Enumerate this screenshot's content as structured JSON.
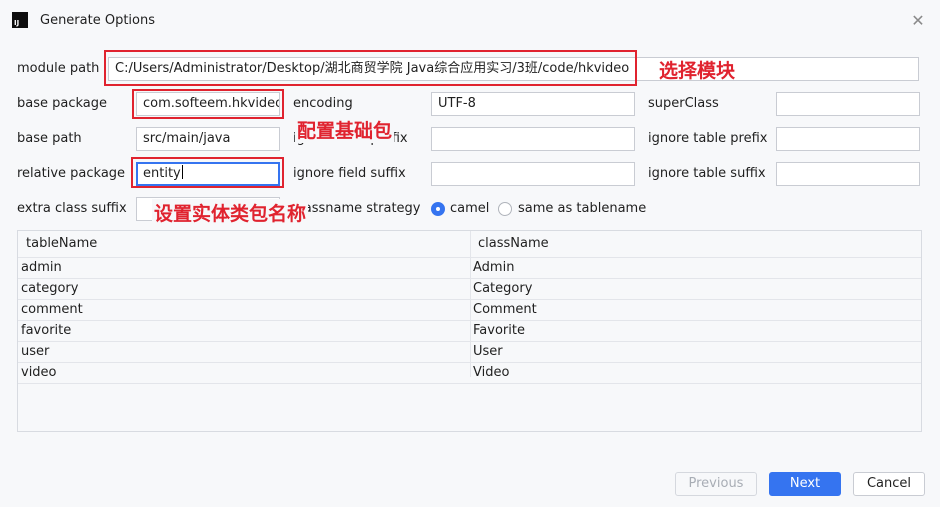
{
  "window": {
    "title": "Generate Options",
    "app_icon_text": "IJ",
    "close_icon": "close-icon"
  },
  "form": {
    "module_path": {
      "label": "module path",
      "value": "C:/Users/Administrator/Desktop/湖北商贸学院 Java综合应用实习/3班/code/hkvideo"
    },
    "base_package": {
      "label": "base package",
      "value": "com.softeem.hkvideo"
    },
    "encoding": {
      "label": "encoding",
      "value": "UTF-8"
    },
    "super_class": {
      "label": "superClass",
      "value": ""
    },
    "base_path": {
      "label": "base path",
      "value": "src/main/java"
    },
    "ignore_field_prefix": {
      "label": "ignore field prefix",
      "value": ""
    },
    "ignore_table_prefix": {
      "label": "ignore table prefix",
      "value": ""
    },
    "relative_package": {
      "label": "relative package",
      "value": "entity"
    },
    "ignore_field_suffix": {
      "label": "ignore field suffix",
      "value": ""
    },
    "ignore_table_suffix": {
      "label": "ignore table suffix",
      "value": ""
    },
    "extra_class_suffix": {
      "label": "extra class suffix",
      "value": ""
    },
    "class_name_strategy": {
      "label": "classname strategy",
      "options": [
        "camel",
        "same as tablename"
      ],
      "selected": "camel"
    }
  },
  "annotations": {
    "select_module": "选择模块",
    "config_base_package": "配置基础包",
    "set_entity_package": "设置实体类包名称",
    "color": "#e0232f"
  },
  "table": {
    "columns": [
      "tableName",
      "className"
    ],
    "rows": [
      [
        "admin",
        "Admin"
      ],
      [
        "category",
        "Category"
      ],
      [
        "comment",
        "Comment"
      ],
      [
        "favorite",
        "Favorite"
      ],
      [
        "user",
        "User"
      ],
      [
        "video",
        "Video"
      ]
    ]
  },
  "buttons": {
    "previous": "Previous",
    "next": "Next",
    "cancel": "Cancel"
  },
  "colors": {
    "accent": "#3574f0",
    "background": "#f7f8fa"
  }
}
